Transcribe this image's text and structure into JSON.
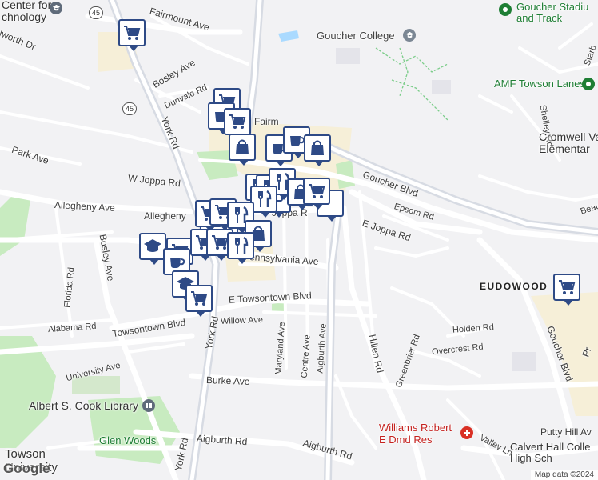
{
  "map": {
    "attribution": "Map data ©2024",
    "logo_text": "Google",
    "streets": [
      {
        "name": "Fairmount Ave",
        "label": "Fairmount Ave"
      },
      {
        "name": "Ilworth Dr",
        "label": "lworth Dr"
      },
      {
        "name": "Bosley Ave",
        "label": "Bosley Ave"
      },
      {
        "name": "Dunvale Rd",
        "label": "Dunvale Rd"
      },
      {
        "name": "York Rd",
        "label": "York Rd"
      },
      {
        "name": "Park Ave",
        "label": "Park Ave"
      },
      {
        "name": "W Joppa Rd",
        "label": "W Joppa Rd"
      },
      {
        "name": "Allegheny Ave (west)",
        "label": "Allegheny Ave"
      },
      {
        "name": "Allegheny (center)",
        "label": "Allegheny"
      },
      {
        "name": "Fairmount (center)",
        "label": "Fairm"
      },
      {
        "name": "Joppa Rd (center)",
        "label": "Joppa R"
      },
      {
        "name": "Pennsylvania Ave",
        "label": "ennsylvania Ave"
      },
      {
        "name": "Bosley Ave (vertical)",
        "label": "Bosley Ave"
      },
      {
        "name": "Florida Rd",
        "label": "Florida Rd"
      },
      {
        "name": "E Towsontown Blvd",
        "label": "E Towsontown Blvd"
      },
      {
        "name": "Towsontown Blvd",
        "label": "Towsontown Blvd"
      },
      {
        "name": "Alabama Rd",
        "label": "Alabama Rd"
      },
      {
        "name": "Willow Ave",
        "label": "Willow Ave"
      },
      {
        "name": "York Rd (south)",
        "label": "York Rd"
      },
      {
        "name": "Maryland Ave",
        "label": "Maryland Ave"
      },
      {
        "name": "Centre Ave",
        "label": "Centre Ave"
      },
      {
        "name": "Aigburth Ave",
        "label": "Aigburth Ave"
      },
      {
        "name": "Hillen Rd",
        "label": "Hillen Rd"
      },
      {
        "name": "University Ave",
        "label": "University Ave"
      },
      {
        "name": "Burke Ave",
        "label": "Burke Ave"
      },
      {
        "name": "Aigburth Rd (west)",
        "label": "Aigburth Rd"
      },
      {
        "name": "Aigburth Rd (east)",
        "label": "Aigburth Rd"
      },
      {
        "name": "York Rd (far south)",
        "label": "York Rd"
      },
      {
        "name": "Goucher Blvd",
        "label": "Goucher Blvd"
      },
      {
        "name": "Goucher Blvd (south)",
        "label": "Goucher Blvd"
      },
      {
        "name": "Epsom Rd",
        "label": "Epsom Rd"
      },
      {
        "name": "E Joppa Rd",
        "label": "E Joppa Rd"
      },
      {
        "name": "Holden Rd",
        "label": "Holden Rd"
      },
      {
        "name": "Greenbrier Rd",
        "label": "Greenbrier Rd"
      },
      {
        "name": "Overcrest Rd",
        "label": "Overcrest Rd"
      },
      {
        "name": "Shelley Rd",
        "label": "Shelley Rd"
      },
      {
        "name": "Putty Hill Ave",
        "label": "Putty Hill Av"
      },
      {
        "name": "Valley Ln",
        "label": "Valley Ln"
      },
      {
        "name": "Beau",
        "label": "Beau"
      },
      {
        "name": "Starb",
        "label": "Starb"
      },
      {
        "name": "Pr",
        "label": "Pr"
      }
    ],
    "places": [
      {
        "name": "Center for Technology",
        "lines": [
          "Center for",
          "chnology"
        ]
      },
      {
        "name": "Goucher College",
        "lines": [
          "Goucher College"
        ]
      },
      {
        "name": "Goucher Stadium and Track",
        "lines": [
          "Goucher Stadiu",
          "and Track"
        ]
      },
      {
        "name": "AMF Towson Lanes",
        "lines": [
          "AMF Towson Lanes"
        ]
      },
      {
        "name": "Cromwell Valley Elementary",
        "lines": [
          "Cromwell Valle",
          "Elementar"
        ]
      },
      {
        "name": "EUDOWOOD",
        "lines": [
          "EUDOWOOD"
        ]
      },
      {
        "name": "Albert S. Cook Library",
        "lines": [
          "Albert S. Cook Library"
        ]
      },
      {
        "name": "Glen Woods",
        "lines": [
          "Glen Woods"
        ]
      },
      {
        "name": "Towson University",
        "lines": [
          "Towson",
          "University"
        ]
      },
      {
        "name": "Williams Robert E Dmd Res",
        "lines": [
          "Williams Robert",
          "E Dmd Res"
        ]
      },
      {
        "name": "Calvert Hall College High School",
        "lines": [
          "Calvert Hall Colle",
          "High Sch"
        ]
      }
    ],
    "route_shields": [
      "45",
      "45"
    ],
    "markers": [
      {
        "icon": "cart-icon"
      },
      {
        "icon": "cart-icon"
      },
      {
        "icon": "coffee-icon"
      },
      {
        "icon": "cart-icon"
      },
      {
        "icon": "bag-icon"
      },
      {
        "icon": "coffee-icon"
      },
      {
        "icon": "coffee-icon"
      },
      {
        "icon": "bag-icon"
      },
      {
        "icon": "restaurant-icon"
      },
      {
        "icon": "restaurant-icon"
      },
      {
        "icon": "restaurant-icon"
      },
      {
        "icon": "bag-icon"
      },
      {
        "icon": "cart-icon"
      },
      {
        "icon": "restaurant-icon"
      },
      {
        "icon": "cart-icon"
      },
      {
        "icon": "cart-icon"
      },
      {
        "icon": "restaurant-icon"
      },
      {
        "icon": "bag-icon"
      },
      {
        "icon": "school-icon"
      },
      {
        "icon": "cart-icon"
      },
      {
        "icon": "coffee-icon"
      },
      {
        "icon": "school-icon"
      },
      {
        "icon": "cart-icon"
      },
      {
        "icon": "cart-icon"
      },
      {
        "icon": "cart-icon"
      },
      {
        "icon": "restaurant-icon"
      },
      {
        "icon": "cart-icon"
      }
    ],
    "colors": {
      "marker_border": "#2e4a86",
      "park": "#c8ebc0",
      "commercial": "#f6efd8",
      "road": "#ffffff",
      "highway": "#d7dbe3",
      "water": "#aadaff"
    }
  }
}
